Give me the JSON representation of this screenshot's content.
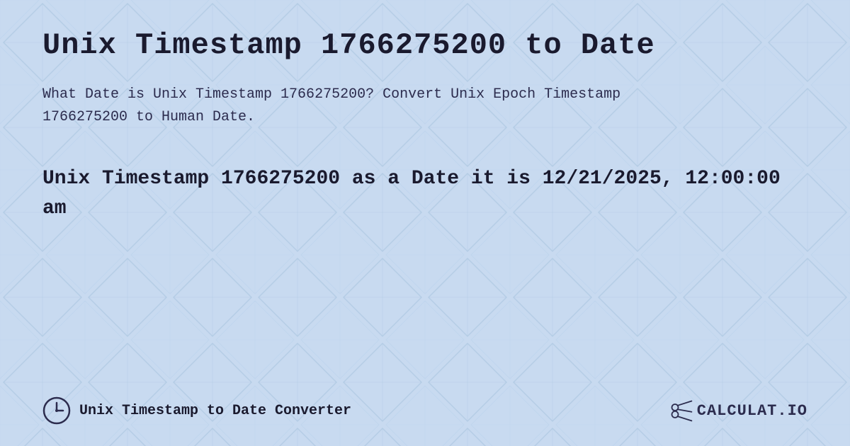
{
  "page": {
    "bg_color": "#c8daf0",
    "title": "Unix Timestamp 1766275200 to Date",
    "description": "What Date is Unix Timestamp 1766275200? Convert Unix Epoch Timestamp 1766275200 to Human Date.",
    "result": "Unix Timestamp 1766275200 as a Date it is 12/21/2025, 12:00:00 am",
    "footer": {
      "link_text": "Unix Timestamp to Date Converter",
      "logo_text": "CALCULAT.IO"
    }
  }
}
